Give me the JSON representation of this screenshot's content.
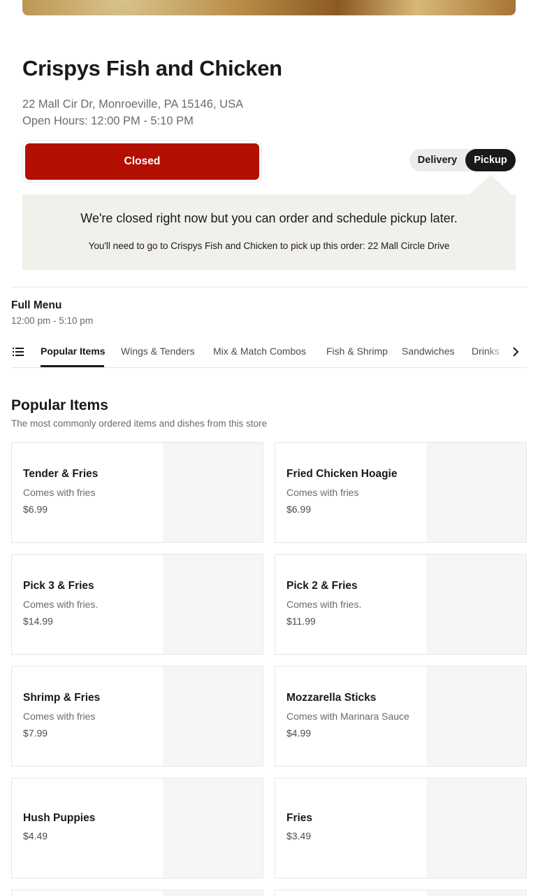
{
  "store": {
    "name": "Crispys Fish and Chicken",
    "address": "22 Mall Cir Dr, Monroeville, PA 15146, USA",
    "hours": "Open Hours: 12:00 PM - 5:10 PM",
    "status_button": "Closed"
  },
  "mode_toggle": {
    "delivery": "Delivery",
    "pickup": "Pickup",
    "selected": "Pickup"
  },
  "notice": {
    "headline": "We're closed right now but you can order and schedule pickup later.",
    "detail": "You'll need to go to Crispys Fish and Chicken to pick up this order: 22 Mall Circle Drive"
  },
  "menu": {
    "title": "Full Menu",
    "hours": "12:00 pm - 5:10 pm"
  },
  "tabs": [
    {
      "label": "Popular Items",
      "active": true
    },
    {
      "label": "Wings & Tenders",
      "active": false
    },
    {
      "label": "Mix & Match Combos",
      "active": false
    },
    {
      "label": "Fish & Shrimp",
      "active": false
    },
    {
      "label": "Sandwiches",
      "active": false
    },
    {
      "label": "Drinks",
      "active": false
    }
  ],
  "section": {
    "title": "Popular Items",
    "subtitle": "The most commonly ordered items and dishes from this store"
  },
  "items": [
    {
      "name": "Tender & Fries",
      "desc": "Comes with fries",
      "price": "$6.99"
    },
    {
      "name": "Fried Chicken Hoagie",
      "desc": "Comes with fries",
      "price": "$6.99"
    },
    {
      "name": "Pick 3 & Fries",
      "desc": "Comes with fries.",
      "price": "$14.99"
    },
    {
      "name": "Pick 2 & Fries",
      "desc": "Comes with fries.",
      "price": "$11.99"
    },
    {
      "name": "Shrimp & Fries",
      "desc": "Comes with fries",
      "price": "$7.99"
    },
    {
      "name": "Mozzarella Sticks",
      "desc": "Comes with Marinara Sauce",
      "price": "$4.99"
    },
    {
      "name": "Hush Puppies",
      "desc": "",
      "price": "$4.49"
    },
    {
      "name": "Fries",
      "desc": "",
      "price": "$3.49"
    }
  ],
  "icons": {
    "tab_list": "list-icon",
    "tab_scroll": "chevron-right-icon"
  },
  "colors": {
    "closed_red": "#b30f00",
    "notice_bg": "#f2f0ea",
    "text": "#191919",
    "muted": "#6b6b6b"
  }
}
